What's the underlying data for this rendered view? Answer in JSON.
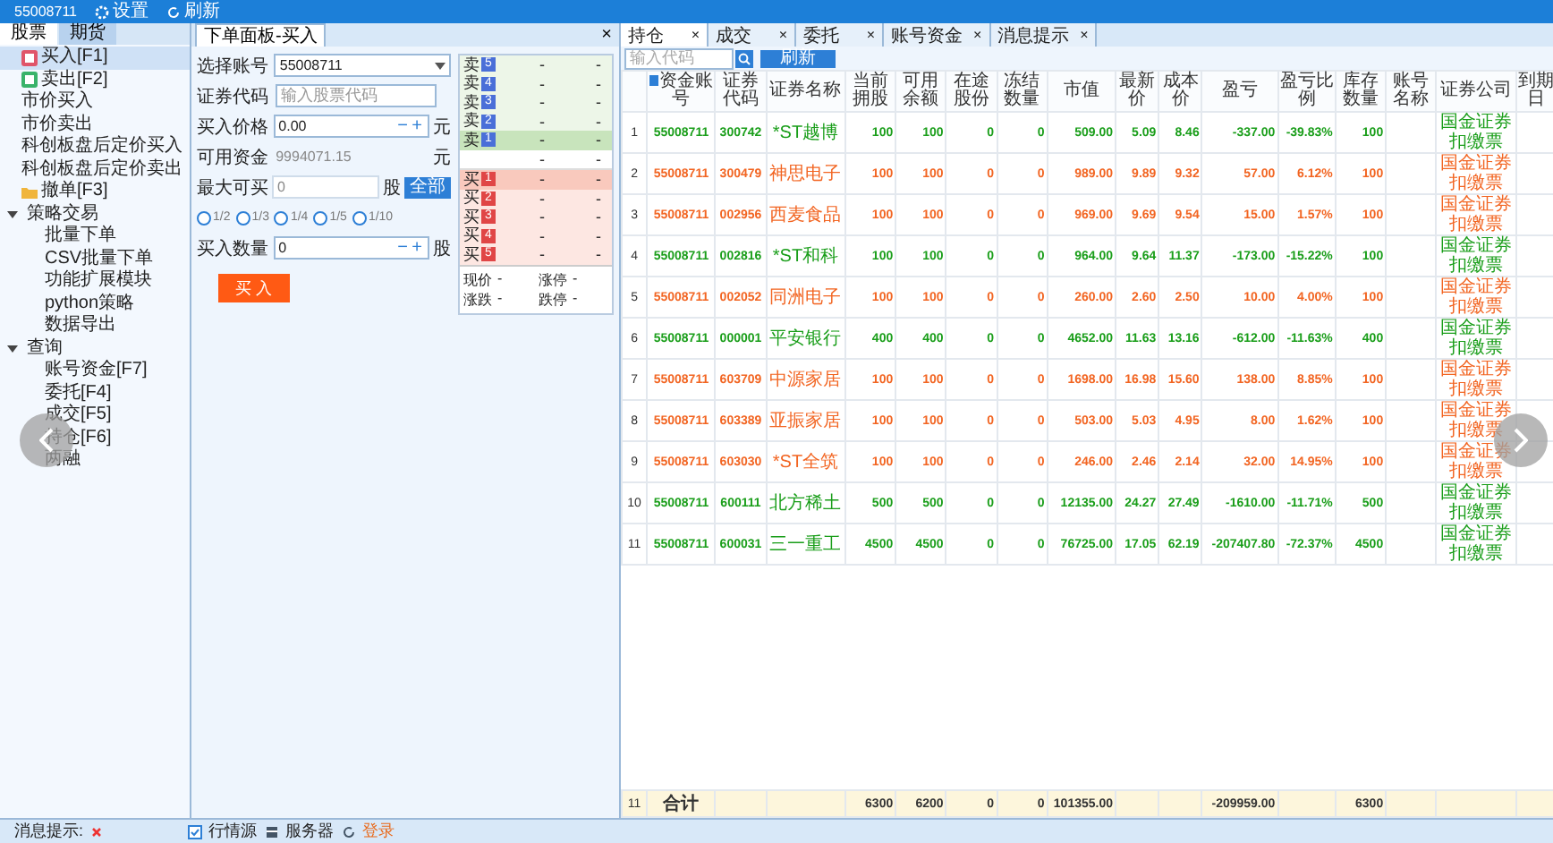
{
  "title_bar": {
    "account": "55008711",
    "settings": "设置",
    "refresh": "刷新"
  },
  "sidebar": {
    "tabs": [
      {
        "label": "股票",
        "selected": true
      },
      {
        "label": "期货",
        "selected": false
      }
    ],
    "items": [
      {
        "label": "买入[F1]",
        "kind": "buy",
        "selected": true
      },
      {
        "label": "卖出[F2]",
        "kind": "sell",
        "selected": false
      },
      {
        "label": "市价买入",
        "kind": "plain",
        "selected": false
      },
      {
        "label": "市价卖出",
        "kind": "plain",
        "selected": false
      },
      {
        "label": "科创板盘后定价买入",
        "kind": "plain",
        "selected": false
      },
      {
        "label": "科创板盘后定价卖出",
        "kind": "plain",
        "selected": false
      },
      {
        "label": "撤单[F3]",
        "kind": "cancel",
        "selected": false
      },
      {
        "label": "策略交易",
        "kind": "group",
        "selected": false,
        "expanded": true,
        "children": [
          {
            "label": "批量下单"
          },
          {
            "label": "CSV批量下单"
          },
          {
            "label": "功能扩展模块"
          },
          {
            "label": "python策略"
          },
          {
            "label": "数据导出"
          }
        ]
      },
      {
        "label": "查询",
        "kind": "group",
        "selected": false,
        "expanded": true,
        "children": [
          {
            "label": "账号资金[F7]"
          },
          {
            "label": "委托[F4]"
          },
          {
            "label": "成交[F5]"
          },
          {
            "label": "持仓[F6]"
          },
          {
            "label": "两融"
          }
        ]
      }
    ]
  },
  "order_panel": {
    "tab": "下单面板-买入",
    "close": "×",
    "account": {
      "label": "选择账号",
      "value": "55008711"
    },
    "code": {
      "label": "证券代码",
      "placeholder": "输入股票代码"
    },
    "price": {
      "label": "买入价格",
      "value": "0.00",
      "minus": "−",
      "plus": "+",
      "unit": "元"
    },
    "funds": {
      "label": "可用资金",
      "value": "9994071.15",
      "unit": "元"
    },
    "max": {
      "label": "最大可买",
      "value": "0",
      "unit": "股",
      "button": "全部"
    },
    "fractions": [
      {
        "label": "1/2",
        "selected": false
      },
      {
        "label": "1/3",
        "selected": false
      },
      {
        "label": "1/4",
        "selected": false
      },
      {
        "label": "1/5",
        "selected": false
      },
      {
        "label": "1/10",
        "selected": false
      }
    ],
    "quantity": {
      "label": "买入数量",
      "value": "0",
      "minus": "−",
      "plus": "+",
      "unit": "股"
    },
    "submit": "买 入",
    "book": {
      "asks": [
        {
          "side": "卖",
          "level": "5",
          "price": "-",
          "volume": "-",
          "highlight": false
        },
        {
          "side": "卖",
          "level": "4",
          "price": "-",
          "volume": "-",
          "highlight": false
        },
        {
          "side": "卖",
          "level": "3",
          "price": "-",
          "volume": "-",
          "highlight": false
        },
        {
          "side": "卖",
          "level": "2",
          "price": "-",
          "volume": "-",
          "highlight": false
        },
        {
          "side": "卖",
          "level": "1",
          "price": "-",
          "volume": "-",
          "highlight": true
        }
      ],
      "mid": {
        "price": "-",
        "volume": "-"
      },
      "bids": [
        {
          "side": "买",
          "level": "1",
          "price": "-",
          "volume": "-",
          "highlight": true
        },
        {
          "side": "买",
          "level": "2",
          "price": "-",
          "volume": "-",
          "highlight": false
        },
        {
          "side": "买",
          "level": "3",
          "price": "-",
          "volume": "-",
          "highlight": false
        },
        {
          "side": "买",
          "level": "4",
          "price": "-",
          "volume": "-",
          "highlight": false
        },
        {
          "side": "买",
          "level": "5",
          "price": "-",
          "volume": "-",
          "highlight": false
        }
      ],
      "stats": [
        [
          "现价",
          "-",
          "涨停",
          "-"
        ],
        [
          "涨跌",
          "-",
          "跌停",
          "-"
        ]
      ]
    }
  },
  "positions": {
    "tabs": [
      {
        "label": "持仓",
        "selected": true,
        "close": "×"
      },
      {
        "label": "成交",
        "selected": false,
        "close": "×"
      },
      {
        "label": "委托",
        "selected": false,
        "close": "×"
      },
      {
        "label": "账号资金",
        "selected": false,
        "close": "×"
      },
      {
        "label": "消息提示",
        "selected": false,
        "close": "×"
      }
    ],
    "search_placeholder": "输入代码",
    "refresh": "刷新",
    "columns": [
      "资金账号",
      "证券代码",
      "证券名称",
      "当前拥股",
      "可用余额",
      "在途股份",
      "冻结数量",
      "市值",
      "最新价",
      "成本价",
      "盈亏",
      "盈亏比例",
      "库存数量",
      "账号名称",
      "证券公司",
      "到期日"
    ],
    "rows": [
      {
        "index": "1",
        "color": "#1a9e1a",
        "cells": [
          "55008711",
          "300742",
          "*ST越博",
          "100",
          "100",
          "0",
          "0",
          "509.00",
          "5.09",
          "8.46",
          "-337.00",
          "-39.83%",
          "100",
          "",
          "国金证券扣缴票",
          ""
        ]
      },
      {
        "index": "2",
        "color": "#f26522",
        "cells": [
          "55008711",
          "300479",
          "神思电子",
          "100",
          "100",
          "0",
          "0",
          "989.00",
          "9.89",
          "9.32",
          "57.00",
          "6.12%",
          "100",
          "",
          "国金证券扣缴票",
          ""
        ]
      },
      {
        "index": "3",
        "color": "#f26522",
        "cells": [
          "55008711",
          "002956",
          "西麦食品",
          "100",
          "100",
          "0",
          "0",
          "969.00",
          "9.69",
          "9.54",
          "15.00",
          "1.57%",
          "100",
          "",
          "国金证券扣缴票",
          ""
        ]
      },
      {
        "index": "4",
        "color": "#1a9e1a",
        "cells": [
          "55008711",
          "002816",
          "*ST和科",
          "100",
          "100",
          "0",
          "0",
          "964.00",
          "9.64",
          "11.37",
          "-173.00",
          "-15.22%",
          "100",
          "",
          "国金证券扣缴票",
          ""
        ]
      },
      {
        "index": "5",
        "color": "#f26522",
        "cells": [
          "55008711",
          "002052",
          "同洲电子",
          "100",
          "100",
          "0",
          "0",
          "260.00",
          "2.60",
          "2.50",
          "10.00",
          "4.00%",
          "100",
          "",
          "国金证券扣缴票",
          ""
        ]
      },
      {
        "index": "6",
        "color": "#1a9e1a",
        "cells": [
          "55008711",
          "000001",
          "平安银行",
          "400",
          "400",
          "0",
          "0",
          "4652.00",
          "11.63",
          "13.16",
          "-612.00",
          "-11.63%",
          "400",
          "",
          "国金证券扣缴票",
          ""
        ]
      },
      {
        "index": "7",
        "color": "#f26522",
        "cells": [
          "55008711",
          "603709",
          "中源家居",
          "100",
          "100",
          "0",
          "0",
          "1698.00",
          "16.98",
          "15.60",
          "138.00",
          "8.85%",
          "100",
          "",
          "国金证券扣缴票",
          ""
        ]
      },
      {
        "index": "8",
        "color": "#f26522",
        "cells": [
          "55008711",
          "603389",
          "亚振家居",
          "100",
          "100",
          "0",
          "0",
          "503.00",
          "5.03",
          "4.95",
          "8.00",
          "1.62%",
          "100",
          "",
          "国金证券扣缴票",
          ""
        ]
      },
      {
        "index": "9",
        "color": "#f26522",
        "cells": [
          "55008711",
          "603030",
          "*ST全筑",
          "100",
          "100",
          "0",
          "0",
          "246.00",
          "2.46",
          "2.14",
          "32.00",
          "14.95%",
          "100",
          "",
          "国金证券扣缴票",
          ""
        ]
      },
      {
        "index": "10",
        "color": "#1a9e1a",
        "cells": [
          "55008711",
          "600111",
          "北方稀土",
          "500",
          "500",
          "0",
          "0",
          "12135.00",
          "24.27",
          "27.49",
          "-1610.00",
          "-11.71%",
          "500",
          "",
          "国金证券扣缴票",
          ""
        ]
      },
      {
        "index": "11",
        "color": "#1a9e1a",
        "cells": [
          "55008711",
          "600031",
          "三一重工",
          "4500",
          "4500",
          "0",
          "0",
          "76725.00",
          "17.05",
          "62.19",
          "-207407.80",
          "-72.37%",
          "4500",
          "",
          "国金证券扣缴票",
          ""
        ]
      }
    ],
    "total": {
      "index": "11",
      "account": "合计",
      "holding": "6300",
      "available": "6200",
      "in_transit": "0",
      "frozen": "0",
      "market_value": "101355.00",
      "pnl": "-209959.00",
      "stock_qty": "6300"
    }
  },
  "status_bar": {
    "messages": "消息提示:",
    "quote_source": "行情源",
    "server": "服务器",
    "login": "登录"
  }
}
